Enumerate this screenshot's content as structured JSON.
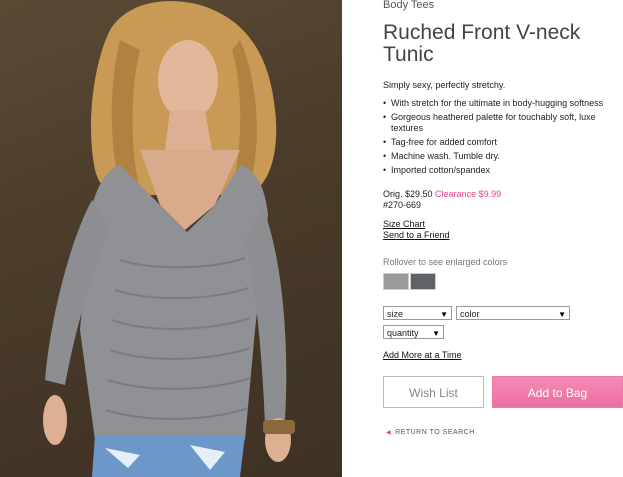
{
  "breadcrumb": "Body Tees",
  "product": {
    "title": "Ruched Front V-neck Tunic",
    "tagline": "Simply sexy, perfectly stretchy.",
    "features": [
      "With stretch for the ultimate in body-hugging softness",
      "Gorgeous heathered palette for touchably soft, luxe textures",
      "Tag-free for added comfort",
      "Machine wash. Tumble dry.",
      "Imported cotton/spandex"
    ],
    "orig_price": "Orig. $29.50",
    "sale_price": "Clearance $9.99",
    "sku": "#270-669"
  },
  "links": {
    "size_chart": "Size Chart",
    "send_friend": "Send to a Friend",
    "add_more": "Add More at a Time"
  },
  "colors": {
    "rollover_text": "Rollover to see enlarged colors",
    "swatches": [
      "#9a9a9a",
      "#5f6266"
    ]
  },
  "selects": {
    "size": "size",
    "color": "color",
    "quantity": "quantity"
  },
  "buttons": {
    "wish_list": "Wish List",
    "add_to_bag": "Add to Bag",
    "return": "RETURN TO SEARCH"
  },
  "theme": {
    "accent": "#e0438b",
    "button_pink": "#ec6ea2"
  }
}
